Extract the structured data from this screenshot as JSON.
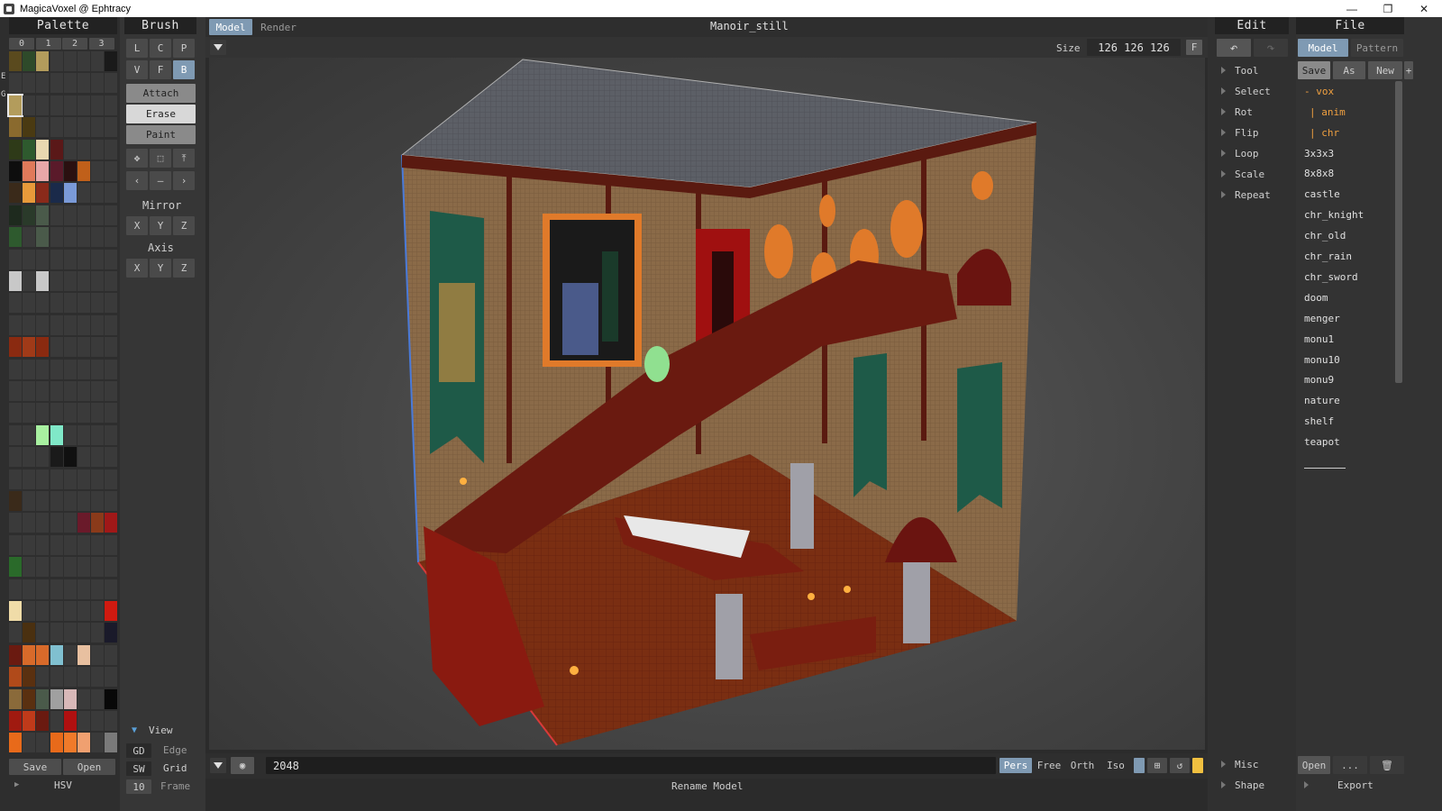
{
  "window": {
    "title": "MagicaVoxel @ Ephtracy"
  },
  "palette": {
    "header": "Palette",
    "pages": [
      "0",
      "1",
      "2",
      "3"
    ],
    "side_marks": [
      "E",
      "G"
    ],
    "save_label": "Save",
    "open_label": "Open",
    "hsv_label": "HSV",
    "colors": {
      "c1": "#5a4a1e",
      "c2": "#2e4a2a",
      "c3": "#b39c5c",
      "c4": "#8a6a2e",
      "c5": "#4a3a12",
      "c6": "#2e3a18",
      "c7": "#2e5a2e",
      "c8": "#e8d8b0",
      "c9": "#5a1818",
      "c10": "#0e0e0e",
      "c11": "#e07a5a",
      "c12": "#e8a8a8",
      "c13": "#5a1a2a",
      "c14": "#2a1010",
      "c15": "#c0601a",
      "c16": "#3a2a1a",
      "c17": "#e89a3a",
      "c18": "#8a2a1a",
      "c19": "#1a2a4a",
      "c20": "#7a9ad8",
      "c21": "#1e2a1e",
      "c22": "#2a3a2a",
      "c23": "#4a5a4a",
      "c24": "#c8c8c8",
      "c25": "#8a2a10",
      "c26": "#a03a18",
      "c27": "#a8f0a0",
      "c28": "#80e8c8",
      "c29": "#1a1a1a",
      "c30": "#101010",
      "c31": "#3a2a1a",
      "c32": "#6a1a2a",
      "c33": "#8a3a1a",
      "c34": "#a01818",
      "c35": "#2a6a2a",
      "c36": "#f0dca8",
      "c37": "#d01a10",
      "c38": "#4a3010",
      "c39": "#1a1a2a",
      "c40": "#6a1a10",
      "c41": "#d86a2a",
      "c42": "#80c0d0",
      "c43": "#e8c0a0",
      "c44": "#b04a1a",
      "c45": "#5a3010",
      "c46": "#8a6a3a",
      "c47": "#c0a890",
      "c48": "#a0a0a0",
      "c49": "#d8b8b8",
      "c50": "#080808",
      "c51": "#a01a10",
      "c52": "#c03a1a",
      "c53": "#e86a1a",
      "c54": "#f07a2a",
      "c55": "#f0a070",
      "c56": "#7a2a1a",
      "c57": "#b01010",
      "c58": "#7a7a7a"
    }
  },
  "brush": {
    "header": "Brush",
    "row1": [
      "L",
      "C",
      "P"
    ],
    "row2": [
      "V",
      "F",
      "B"
    ],
    "modes": [
      "Attach",
      "Erase",
      "Paint"
    ],
    "mirror_label": "Mirror",
    "axis_label": "Axis",
    "axes": [
      "X",
      "Y",
      "Z"
    ]
  },
  "view": {
    "label": "View",
    "rows": [
      {
        "key": "GD",
        "name": "Edge"
      },
      {
        "key": "SW",
        "name": "Grid"
      },
      {
        "key": "10",
        "name": "Frame"
      }
    ]
  },
  "top": {
    "tabs": [
      "Model",
      "Render"
    ],
    "file_title": "Manoir_still",
    "size_label": "Size",
    "size_value": "126 126 126",
    "f_label": "F"
  },
  "bottom": {
    "input_value": "2048",
    "projections": [
      "Pers",
      "Free",
      "Orth",
      "Iso"
    ],
    "status": "Rename Model"
  },
  "edit": {
    "header": "Edit",
    "items": [
      "Tool",
      "Select",
      "Rot",
      "Flip",
      "Loop",
      "Scale",
      "Repeat"
    ],
    "misc": "Misc",
    "shape": "Shape"
  },
  "file": {
    "header": "File",
    "tabs": [
      "Model",
      "Pattern"
    ],
    "actions": [
      "Save",
      "As",
      "New",
      "+"
    ],
    "folders": [
      "- vox",
      "| anim",
      "| chr"
    ],
    "files": [
      "3x3x3",
      "8x8x8",
      "castle",
      "chr_knight",
      "chr_old",
      "chr_rain",
      "chr_sword",
      "doom",
      "menger",
      "monu1",
      "monu10",
      "monu9",
      "nature",
      "shelf",
      "teapot"
    ],
    "open_label": "Open",
    "more_label": "...",
    "export_label": "Export",
    "accent": "#f0a040"
  }
}
